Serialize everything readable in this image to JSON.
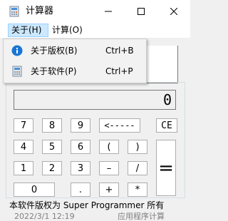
{
  "window": {
    "title": "计算器",
    "icon": "calculator-icon",
    "controls": [
      "minimize-icon",
      "maximize-icon",
      "close-icon"
    ]
  },
  "menubar": {
    "about": "关于(H)",
    "calc": "计算(O)"
  },
  "dropdown": {
    "items": [
      {
        "label": "关于版权(B)",
        "shortcut": "Ctrl+B",
        "icon": "info-icon"
      },
      {
        "label": "关于软件(P)",
        "shortcut": "Ctrl+P",
        "icon": "calculator-icon"
      }
    ]
  },
  "display": {
    "value": "0"
  },
  "buttons": {
    "b7": "7",
    "b8": "8",
    "b9": "9",
    "backspace": "<-----",
    "ce": "CE",
    "b4": "4",
    "b5": "5",
    "b6": "6",
    "lparen": "(",
    "rparen": ")",
    "b1": "1",
    "b2": "2",
    "b3": "3",
    "minus": "–",
    "divide": "/",
    "b0": "0",
    "dot": ".",
    "plus": "+",
    "multiply": "*",
    "equals": "="
  },
  "status": {
    "copyright": "本软件版权为 Super Programmer 所有",
    "partial_left": "2022/3/1 12:19",
    "partial_right": "应用程序计算"
  },
  "colors": {
    "accent": "#0078d7",
    "menu_highlight": "#cce8ff"
  }
}
